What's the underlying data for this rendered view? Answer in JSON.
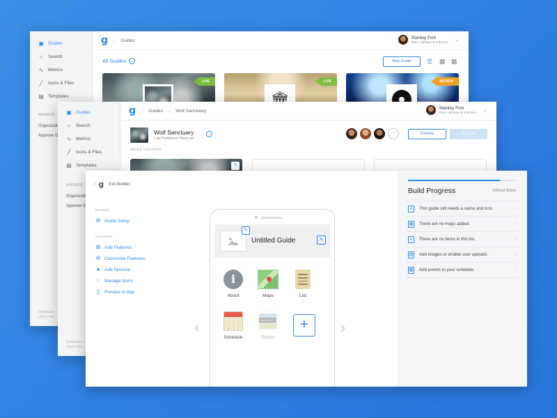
{
  "colors": {
    "accent": "#2f86e3",
    "live": "#7bbd3c",
    "review": "#f0a020",
    "background": "#2f7fe0"
  },
  "w1": {
    "sidebar": {
      "items": [
        {
          "label": "Guides",
          "icon": "book-icon"
        },
        {
          "label": "Search",
          "icon": "search-icon"
        },
        {
          "label": "Metrics",
          "icon": "pulse-icon"
        },
        {
          "label": "Icons & Files",
          "icon": "pencil-icon"
        },
        {
          "label": "Templates",
          "icon": "template-icon"
        }
      ],
      "manage_heading": "MANAGE",
      "manage_items": [
        "Organizatio",
        "Approve G"
      ],
      "footer": [
        "Guidebook I",
        "About • Pric"
      ]
    },
    "crumb": "Guides",
    "user": {
      "name": "Stanley Fich",
      "plan": "Plus • Johnson & Johnson"
    },
    "all_guides": "All Guides",
    "new_guide": "New Guide",
    "cards": [
      {
        "tag": "LIVE"
      },
      {
        "tag": "LIVE"
      },
      {
        "tag": "REVIEW"
      }
    ]
  },
  "w2": {
    "sidebar": {
      "items": [
        {
          "label": "Guides",
          "icon": "book-icon"
        },
        {
          "label": "Search",
          "icon": "search-icon"
        },
        {
          "label": "Metrics",
          "icon": "pulse-icon"
        },
        {
          "label": "Icons & Files",
          "icon": "pencil-icon"
        },
        {
          "label": "Templates",
          "icon": "template-icon"
        }
      ],
      "manage_heading": "MANAGE",
      "manage_items": [
        "Organizatio",
        "Approve G"
      ],
      "footer": [
        "Guidebook I",
        "About • Pric"
      ]
    },
    "crumbs": [
      "Guides",
      "Wolf Sanctuary"
    ],
    "user": {
      "name": "Stanley Fich",
      "plan": "Plus • Johnson & Johnson"
    },
    "guide_title": "Wolf Sanctuary",
    "guide_sub": "Last Published: None yet",
    "preview": "Preview",
    "go_live": "Go Live",
    "section_label": "GUIDE CONTENT"
  },
  "w3": {
    "exit": "Exit Builder",
    "basics_heading": "BASICS",
    "basics": [
      {
        "label": "Guide Setup",
        "icon": "setup-icon"
      }
    ],
    "actions_heading": "ACTIONS",
    "actions": [
      {
        "label": "Add Features",
        "icon": "add-features-icon"
      },
      {
        "label": "Customize Features",
        "icon": "customize-icon"
      },
      {
        "label": "Add Sponsor",
        "icon": "sponsor-icon"
      },
      {
        "label": "Manage Icons",
        "icon": "manage-icons-icon"
      },
      {
        "label": "Preview in App",
        "icon": "preview-app-icon"
      }
    ],
    "phone_title": "Untitled Guide",
    "features": [
      {
        "label": "About",
        "icon": "info-icon"
      },
      {
        "label": "Maps",
        "icon": "map-icon"
      },
      {
        "label": "List",
        "icon": "list-doc-icon"
      },
      {
        "label": "Schedule",
        "icon": "calendar-icon"
      },
      {
        "label": "Photos",
        "icon": "photos-icon",
        "badge": "DISABLED"
      }
    ],
    "progress_title": "Build Progress",
    "progress_status": "Almost there",
    "progress": 0.85,
    "tasks": [
      "This guide still needs a name and icon.",
      "There are no maps added.",
      "There are no items in this list.",
      "Add images or enable user uploads.",
      "Add events to your schedule."
    ]
  }
}
